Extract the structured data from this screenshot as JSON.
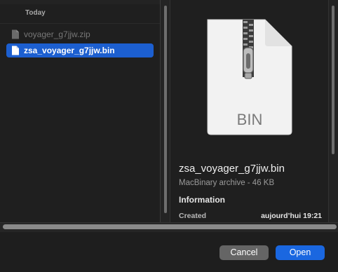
{
  "section_header": "Today",
  "files": [
    {
      "name": "voyager_g7jjw.zip",
      "state": "disabled"
    },
    {
      "name": "zsa_voyager_g7jjw.bin",
      "state": "selected"
    }
  ],
  "preview": {
    "icon_label": "BIN",
    "icon_name": "zip-document-icon",
    "file_name": "zsa_voyager_g7jjw.bin",
    "kind_size": "MacBinary archive - 46 KB",
    "info_title": "Information",
    "info_rows": [
      {
        "label": "Created",
        "value": "aujourd’hui 19:21"
      }
    ]
  },
  "buttons": {
    "cancel": "Cancel",
    "open": "Open"
  },
  "colors": {
    "selection": "#1c5fd0",
    "primary_button": "#1a67e0",
    "secondary_button": "#656565"
  }
}
